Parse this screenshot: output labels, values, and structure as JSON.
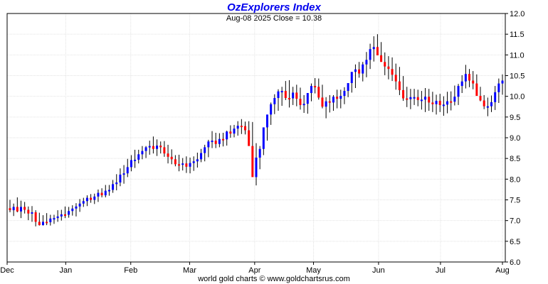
{
  "chart_data": {
    "type": "ohlc",
    "title": "OzExplorers Index",
    "subtitle": "Aug-08  2025   Close = 10.38",
    "footer": "world gold charts © www.goldchartsrus.com",
    "ylim": [
      6.0,
      12.0
    ],
    "y_ticks": [
      "6.0",
      "6.5",
      "7.0",
      "7.5",
      "8.0",
      "8.5",
      "9.0",
      "9.5",
      "10.0",
      "10.5",
      "11.0",
      "11.5",
      "12.0"
    ],
    "x_ticks": [
      "Dec",
      "Jan",
      "Feb",
      "Mar",
      "Apr",
      "May",
      "Jun",
      "Jul",
      "Aug"
    ],
    "grid": true,
    "up_color": "#0000ff",
    "down_color": "#ff0000",
    "series": {
      "open": [
        7.3,
        7.25,
        7.33,
        7.22,
        7.33,
        7.26,
        7.17,
        7.2,
        6.97,
        6.89,
        6.97,
        6.96,
        7.05,
        7.06,
        7.1,
        7.15,
        7.14,
        7.23,
        7.29,
        7.34,
        7.41,
        7.47,
        7.55,
        7.5,
        7.58,
        7.67,
        7.61,
        7.72,
        7.74,
        7.88,
        7.92,
        8.11,
        8.14,
        8.29,
        8.46,
        8.47,
        8.6,
        8.68,
        8.77,
        8.8,
        8.73,
        8.81,
        8.77,
        8.62,
        8.54,
        8.48,
        8.36,
        8.35,
        8.38,
        8.3,
        8.39,
        8.43,
        8.48,
        8.63,
        8.77,
        8.91,
        8.93,
        8.85,
        8.97,
        8.96,
        9.15,
        9.1,
        9.22,
        9.29,
        9.28,
        9.18,
        8.8,
        8.05,
        8.52,
        8.73,
        9.25,
        9.56,
        9.81,
        9.96,
        10.12,
        10.13,
        9.96,
        9.95,
        10.09,
        9.94,
        9.79,
        9.82,
        10.08,
        10.25,
        10.23,
        9.97,
        9.75,
        9.88,
        9.85,
        9.99,
        9.94,
        10.01,
        10.13,
        10.32,
        10.59,
        10.65,
        10.55,
        10.77,
        10.88,
        11.14,
        11.19,
        10.99,
        10.83,
        10.72,
        10.66,
        10.52,
        10.36,
        10.15,
        9.95,
        9.93,
        9.98,
        9.98,
        9.91,
        9.92,
        9.99,
        9.85,
        9.81,
        9.89,
        9.79,
        9.8,
        9.88,
        9.87,
        9.99,
        10.25,
        10.36,
        10.54,
        10.38,
        10.31,
        10.01,
        9.9,
        9.76,
        9.76,
        9.86,
        10.1,
        10.31
      ],
      "high": [
        7.5,
        7.41,
        7.56,
        7.48,
        7.45,
        7.34,
        7.35,
        7.25,
        7.19,
        7.13,
        7.18,
        7.14,
        7.14,
        7.25,
        7.26,
        7.34,
        7.33,
        7.37,
        7.42,
        7.52,
        7.55,
        7.61,
        7.64,
        7.65,
        7.75,
        7.78,
        7.86,
        7.86,
        7.98,
        8.12,
        8.26,
        8.34,
        8.49,
        8.58,
        8.71,
        8.71,
        8.8,
        8.8,
        8.93,
        9.03,
        8.96,
        8.91,
        8.92,
        8.83,
        8.72,
        8.58,
        8.59,
        8.51,
        8.55,
        8.52,
        8.55,
        8.64,
        8.73,
        8.83,
        8.95,
        9.16,
        9.12,
        9.11,
        9.12,
        9.17,
        9.3,
        9.31,
        9.4,
        9.45,
        9.39,
        9.4,
        9.38,
        8.87,
        8.8,
        9.12,
        9.42,
        9.85,
        10.05,
        10.17,
        10.23,
        10.37,
        10.39,
        10.23,
        10.28,
        10.21,
        10.03,
        10.02,
        10.31,
        10.44,
        10.43,
        10.28,
        9.98,
        10.03,
        10.03,
        10.16,
        10.16,
        10.22,
        10.29,
        10.54,
        10.77,
        10.83,
        10.83,
        11.07,
        11.27,
        11.45,
        11.5,
        11.31,
        11.06,
        10.97,
        10.94,
        10.79,
        10.71,
        10.49,
        10.23,
        10.18,
        10.18,
        10.16,
        10.13,
        10.2,
        10.18,
        10.11,
        10.04,
        10.06,
        10.0,
        10.11,
        10.12,
        10.26,
        10.3,
        10.51,
        10.76,
        10.66,
        10.61,
        10.53,
        10.23,
        10.03,
        9.97,
        10.02,
        10.25,
        10.43,
        10.53
      ],
      "low": [
        7.2,
        7.11,
        7.2,
        7.06,
        7.17,
        7.01,
        6.97,
        6.86,
        6.88,
        6.88,
        6.89,
        6.88,
        6.92,
        6.97,
        7.0,
        7.06,
        7.07,
        7.12,
        7.1,
        7.21,
        7.33,
        7.35,
        7.43,
        7.4,
        7.45,
        7.56,
        7.56,
        7.6,
        7.67,
        7.73,
        7.83,
        7.89,
        8.05,
        8.19,
        8.27,
        8.38,
        8.48,
        8.51,
        8.59,
        8.62,
        8.56,
        8.62,
        8.54,
        8.38,
        8.36,
        8.31,
        8.19,
        8.21,
        8.15,
        8.14,
        8.2,
        8.28,
        8.41,
        8.43,
        8.53,
        8.75,
        8.75,
        8.77,
        8.79,
        8.81,
        9.0,
        9.01,
        9.05,
        9.09,
        9.08,
        9.05,
        8.33,
        7.85,
        8.24,
        8.58,
        8.93,
        9.31,
        9.57,
        9.65,
        9.77,
        9.91,
        9.73,
        9.79,
        9.76,
        9.68,
        9.6,
        9.58,
        9.88,
        10.07,
        9.92,
        9.71,
        9.47,
        9.61,
        9.65,
        9.71,
        9.71,
        9.81,
        9.98,
        10.09,
        10.2,
        10.45,
        10.36,
        10.46,
        10.66,
        10.84,
        10.99,
        10.85,
        10.51,
        10.41,
        10.37,
        10.16,
        10.03,
        9.89,
        9.74,
        9.69,
        9.79,
        9.76,
        9.68,
        9.62,
        9.65,
        9.62,
        9.56,
        9.62,
        9.53,
        9.59,
        9.66,
        9.78,
        9.79,
        10.08,
        10.19,
        10.22,
        10.17,
        10.12,
        9.88,
        9.69,
        9.52,
        9.62,
        9.67,
        9.84,
        10.04
      ],
      "close": [
        7.25,
        7.33,
        7.22,
        7.33,
        7.26,
        7.17,
        7.2,
        6.97,
        6.89,
        6.97,
        6.96,
        7.05,
        7.06,
        7.1,
        7.15,
        7.14,
        7.23,
        7.29,
        7.34,
        7.41,
        7.47,
        7.55,
        7.5,
        7.58,
        7.67,
        7.61,
        7.72,
        7.74,
        7.88,
        7.92,
        8.11,
        8.14,
        8.29,
        8.46,
        8.47,
        8.6,
        8.68,
        8.77,
        8.8,
        8.73,
        8.81,
        8.77,
        8.62,
        8.54,
        8.48,
        8.36,
        8.35,
        8.38,
        8.3,
        8.39,
        8.43,
        8.48,
        8.63,
        8.77,
        8.91,
        8.93,
        8.85,
        8.97,
        8.96,
        9.15,
        9.1,
        9.22,
        9.29,
        9.28,
        9.18,
        8.8,
        8.05,
        8.52,
        8.73,
        9.25,
        9.56,
        9.81,
        9.96,
        10.12,
        10.13,
        9.96,
        9.95,
        10.09,
        9.94,
        9.79,
        9.82,
        10.08,
        10.25,
        10.23,
        9.97,
        9.75,
        9.88,
        9.85,
        9.99,
        9.94,
        10.01,
        10.13,
        10.32,
        10.59,
        10.65,
        10.55,
        10.77,
        10.88,
        11.14,
        11.19,
        10.99,
        10.83,
        10.72,
        10.66,
        10.52,
        10.36,
        10.15,
        9.95,
        9.93,
        9.98,
        9.98,
        9.91,
        9.92,
        9.99,
        9.85,
        9.81,
        9.89,
        9.79,
        9.8,
        9.88,
        9.87,
        9.99,
        10.25,
        10.36,
        10.54,
        10.38,
        10.31,
        10.01,
        9.9,
        9.76,
        9.76,
        9.86,
        10.1,
        10.31,
        10.38
      ]
    }
  }
}
